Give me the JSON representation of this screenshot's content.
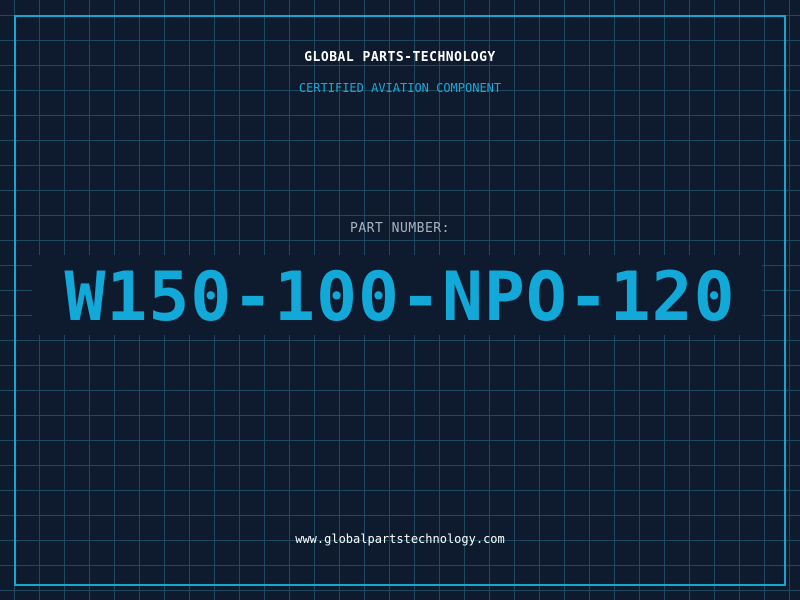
{
  "header": {
    "brand": "GLOBAL PARTS-TECHNOLOGY",
    "tagline": "CERTIFIED AVIATION COMPONENT"
  },
  "part": {
    "label": "PART NUMBER:",
    "number": "W150-100-NPO-120"
  },
  "footer": {
    "website": "www.globalpartstechnology.com"
  },
  "colors": {
    "background": "#0e1a2e",
    "grid": "#1d4a60",
    "accent": "#16a6cf",
    "text": "#ffffff"
  }
}
